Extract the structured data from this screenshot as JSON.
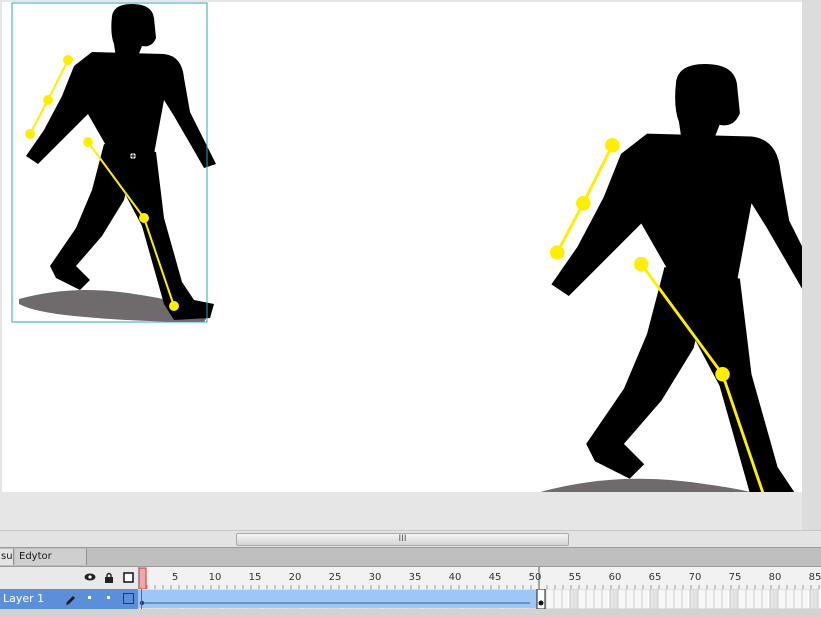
{
  "tabs": [
    {
      "label": "su",
      "active": true
    },
    {
      "label": "Edytor ruchu",
      "active": false
    }
  ],
  "scrollbar": {
    "grip": "III"
  },
  "timeline": {
    "ticks": [
      "5",
      "10",
      "15",
      "20",
      "25",
      "30",
      "35",
      "40",
      "45",
      "50",
      "55",
      "60",
      "65",
      "70",
      "75",
      "80",
      "85"
    ],
    "current_frame": 1,
    "tween_end_frame": 50
  },
  "layer": {
    "name": "Layer 1"
  },
  "icons": {
    "visibility": "eye-icon",
    "lock": "padlock-icon",
    "outline": "outline-square-icon",
    "edit": "pencil-icon"
  },
  "colors": {
    "bone": "#ffee00",
    "selection": "#2aa8b8",
    "layer_selected": "#5b8fd9",
    "tween": "#9ec6f6",
    "playhead": "#e03030"
  }
}
